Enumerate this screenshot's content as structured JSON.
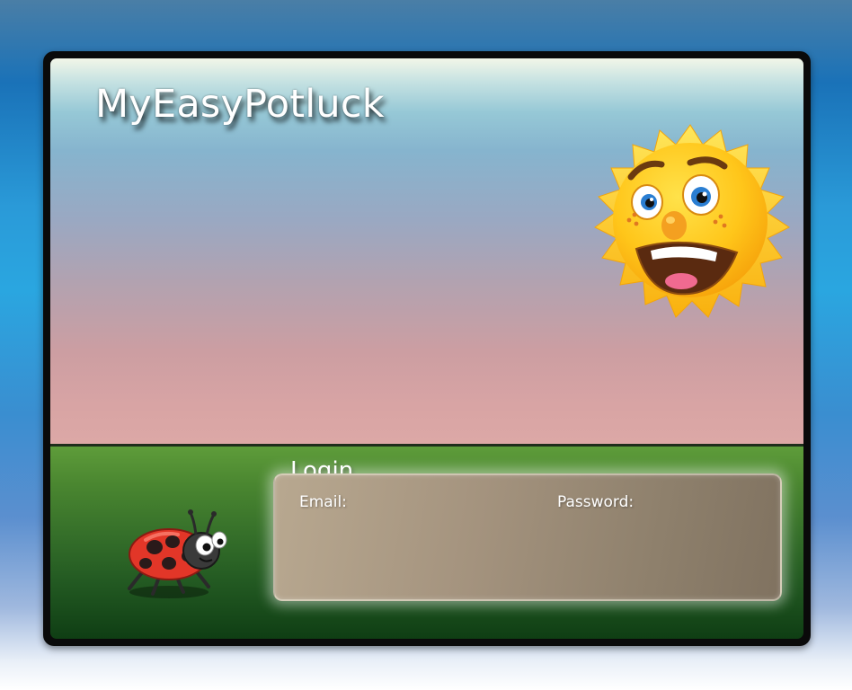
{
  "app": {
    "title": "MyEasyPotluck"
  },
  "login": {
    "title": "Login",
    "email_label": "Email:",
    "password_label": "Password:"
  },
  "illustrations": {
    "sun": "smiling-sun-icon",
    "ladybug": "ladybug-icon"
  },
  "colors": {
    "page_background": "#2aa6e0",
    "frame": "#0a0a0a",
    "sky_top": "#86b4ce",
    "sky_bottom": "#dca8a6",
    "grass_top": "#5e9c3a",
    "grass_bottom": "#0f3e14",
    "panel": "#a4937e",
    "text": "#ffffff"
  }
}
